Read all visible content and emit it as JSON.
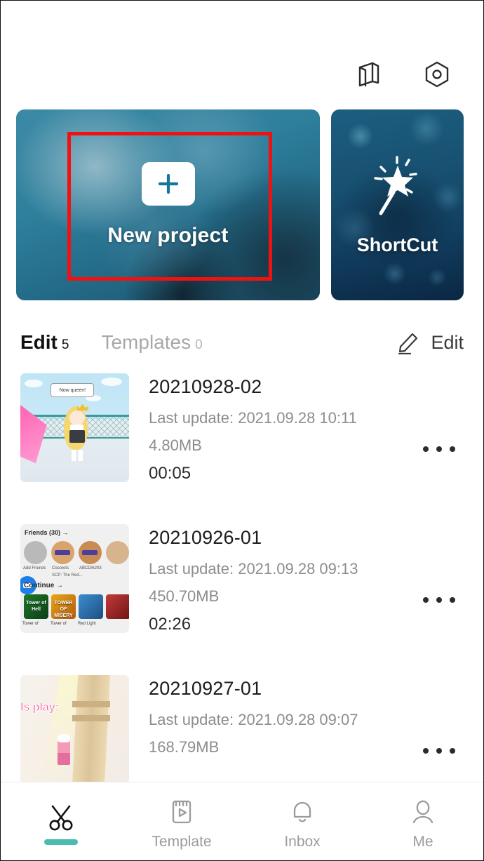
{
  "header": {
    "tutorial_icon": "book-icon",
    "settings_icon": "hexagon-settings-icon"
  },
  "cards": {
    "new_project": {
      "label": "New project",
      "icon": "plus-icon",
      "highlight_color": "#f21111",
      "bg_color": "#2e7f9c"
    },
    "shortcut": {
      "label": "ShortCut",
      "icon": "magic-wand-icon",
      "bg_color": "#174f70"
    }
  },
  "tabs": [
    {
      "label": "Edit",
      "count": "5",
      "active": true
    },
    {
      "label": "Templates",
      "count": "0",
      "active": false
    }
  ],
  "edit_action": {
    "label": "Edit",
    "icon": "pencil-icon"
  },
  "projects": [
    {
      "title": "20210928-02",
      "last_update": "Last update: 2021.09.28 10:11",
      "size": "4.80MB",
      "duration": "00:05",
      "thumbnail": {
        "kind": "anime-character",
        "speech_bubble": "Now queen!"
      }
    },
    {
      "title": "20210926-01",
      "last_update": "Last update: 2021.09.28 09:13",
      "size": "450.70MB",
      "duration": "02:26",
      "thumbnail": {
        "kind": "roblox-home",
        "friends_header": "Friends (30) →",
        "avatar_labels": [
          "Add Friends",
          "Cocorets",
          "ABCD/6203"
        ],
        "avatar_sub": "SCP: The Red...",
        "continue_header": "Continue →",
        "game_tiles": [
          "Tower of Hell",
          "TOWER OF MISERY",
          "Red Light"
        ],
        "tile_labels": [
          "Tower of",
          "Tower of",
          "Red Light"
        ]
      }
    },
    {
      "title": "20210927-01",
      "last_update": "Last update: 2021.09.28 09:07",
      "size": "168.79MB",
      "duration": "",
      "thumbnail": {
        "kind": "pink-play-scene",
        "overlay_text": "ls play:"
      }
    }
  ],
  "more_menu_icon": "three-dots-icon",
  "bottom_nav": {
    "active_color": "#4cbcae",
    "items": [
      {
        "label": "",
        "icon": "scissors-icon",
        "active": true
      },
      {
        "label": "Template",
        "icon": "film-play-icon",
        "active": false
      },
      {
        "label": "Inbox",
        "icon": "bell-icon",
        "active": false
      },
      {
        "label": "Me",
        "icon": "person-icon",
        "active": false
      }
    ]
  }
}
